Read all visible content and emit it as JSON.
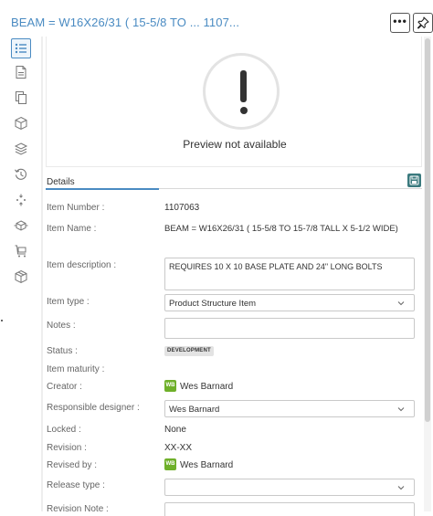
{
  "header": {
    "title": "BEAM = W16X26/31 ( 15-5/8 TO ... 1107...",
    "more_label": "•••"
  },
  "sidebar": {
    "items": [
      {
        "icon": "list-icon",
        "active": true
      },
      {
        "icon": "document-icon"
      },
      {
        "icon": "copy-icon"
      },
      {
        "icon": "cube-icon"
      },
      {
        "icon": "layers-icon"
      },
      {
        "icon": "history-icon"
      },
      {
        "icon": "arrows-icon"
      },
      {
        "icon": "box-flow-icon"
      },
      {
        "icon": "cart-icon"
      },
      {
        "icon": "package-icon"
      }
    ]
  },
  "preview": {
    "message": "Preview not available"
  },
  "details": {
    "tab_label": "Details",
    "fields": {
      "item_number": {
        "label": "Item Number :",
        "value": "1107063"
      },
      "item_name": {
        "label": "Item Name :",
        "value": "BEAM = W16X26/31  ( 15-5/8 TO 15-7/8 TALL X 5-1/2 WIDE)"
      },
      "item_description": {
        "label": "Item description :",
        "value": "REQUIRES 10 X 10 BASE PLATE AND 24\" LONG BOLTS"
      },
      "item_type": {
        "label": "Item type :",
        "value": "Product Structure Item"
      },
      "notes": {
        "label": "Notes :",
        "value": ""
      },
      "status": {
        "label": "Status :",
        "value": "DEVELOPMENT"
      },
      "item_maturity": {
        "label": "Item maturity :",
        "value": ""
      },
      "creator": {
        "label": "Creator :",
        "initials": "WB",
        "value": "Wes Barnard"
      },
      "responsible_designer": {
        "label": "Responsible designer :",
        "value": "Wes Barnard"
      },
      "locked": {
        "label": "Locked :",
        "value": "None"
      },
      "revision": {
        "label": "Revision :",
        "value": "XX-XX"
      },
      "revised_by": {
        "label": "Revised by :",
        "initials": "WB",
        "value": "Wes Barnard"
      },
      "release_type": {
        "label": "Release type :",
        "value": ""
      },
      "revision_note": {
        "label": "Revision Note :",
        "value": ""
      }
    }
  },
  "colors": {
    "accent": "#4a8bc2",
    "save_button": "#3b7a7e",
    "avatar": "#6fb02a"
  }
}
